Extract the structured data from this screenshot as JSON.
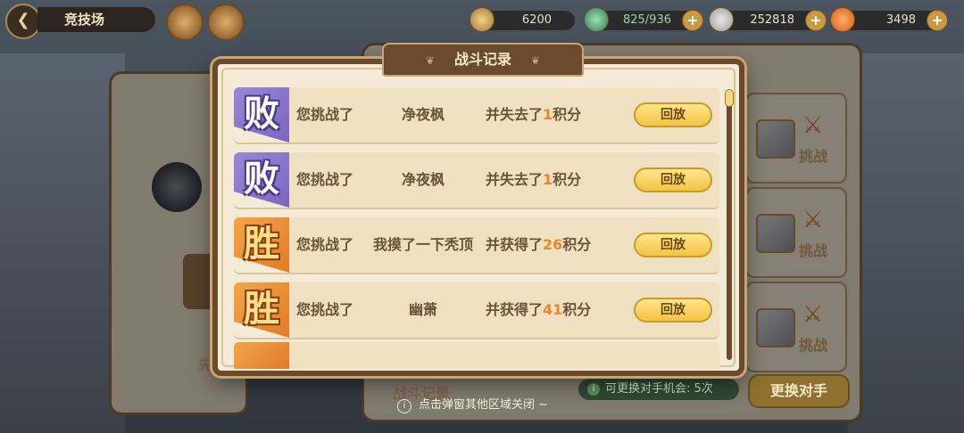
{
  "top_bar": {
    "page_title": "竞技场",
    "resources": [
      {
        "icon": "coin-icon",
        "value": "6200"
      },
      {
        "icon": "energy-potion-icon",
        "value": "825/936"
      },
      {
        "icon": "gem-icon",
        "value": "252818"
      },
      {
        "icon": "carrot-icon",
        "value": "3498"
      }
    ]
  },
  "modal": {
    "title": "战斗记录",
    "records": [
      {
        "result": "败",
        "type": "lose",
        "prefix": "您挑战了",
        "opponent": "净夜枫",
        "outcome_pre": "并失去了",
        "points": "1",
        "outcome_post": "积分",
        "replay": "回放"
      },
      {
        "result": "败",
        "type": "lose",
        "prefix": "您挑战了",
        "opponent": "净夜枫",
        "outcome_pre": "并失去了",
        "points": "1",
        "outcome_post": "积分",
        "replay": "回放"
      },
      {
        "result": "胜",
        "type": "win",
        "prefix": "您挑战了",
        "opponent": "我摸了一下秃顶",
        "outcome_pre": "并获得了",
        "points": "26",
        "outcome_post": "积分",
        "replay": "回放"
      },
      {
        "result": "胜",
        "type": "win",
        "prefix": "您挑战了",
        "opponent": "幽萧",
        "outcome_pre": "并获得了",
        "points": "41",
        "outcome_post": "积分",
        "replay": "回放"
      }
    ]
  },
  "background": {
    "tab_label": "战斗记录",
    "chance_text": "可更换对手机会: 5次",
    "change_button": "更换对手",
    "challenge_label": "挑战",
    "left_partial": "先"
  },
  "hint": "点击弹窗其他区域关闭 ~"
}
